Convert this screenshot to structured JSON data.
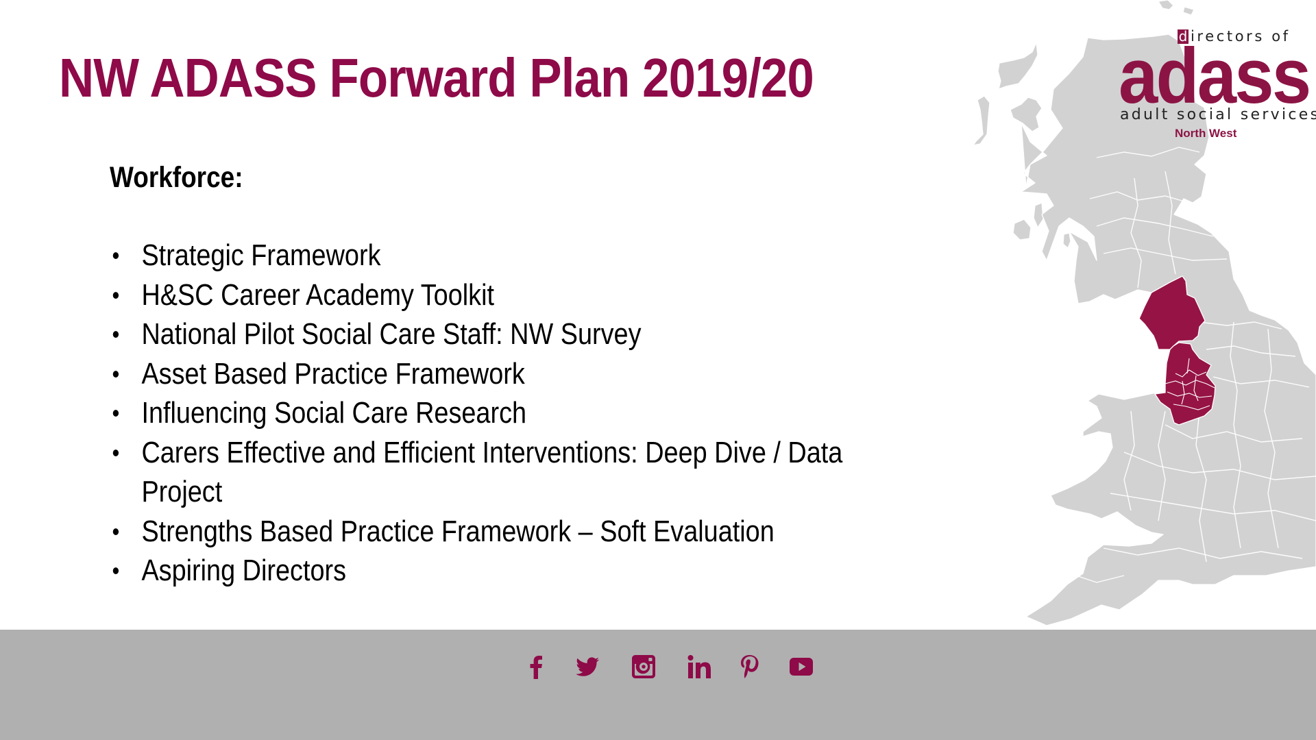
{
  "slide": {
    "title": "NW ADASS Forward Plan 2019/20",
    "section_heading": "Workforce:",
    "items": [
      {
        "lines": [
          "Strategic Framework"
        ]
      },
      {
        "lines": [
          "H&SC Career Academy Toolkit"
        ]
      },
      {
        "lines": [
          "National Pilot Social Care Staff: NW Survey"
        ]
      },
      {
        "lines": [
          "Asset Based Practice Framework"
        ]
      },
      {
        "lines": [
          "Influencing Social Care Research"
        ]
      },
      {
        "lines": [
          "Carers Effective and Efficient Interventions: Deep Dive / Data",
          "Project"
        ]
      },
      {
        "lines": [
          "Strengths Based Practice Framework – Soft Evaluation"
        ]
      },
      {
        "lines": [
          "Aspiring Directors"
        ]
      }
    ],
    "bullet_glyph": "•"
  },
  "logo": {
    "d_letter": "d",
    "directors_of": "irectors of",
    "wordmark": "adass",
    "tagline": "adult social services",
    "region": "North West"
  },
  "map": {
    "description": "Map of Great Britain with North West England region highlighted",
    "highlighted_region": "North West England",
    "colors": {
      "land": "#d2d2d2",
      "highlight": "#961445",
      "borders": "#ffffff"
    }
  },
  "footer": {
    "social_icons": [
      {
        "name": "facebook-icon",
        "label": "Facebook"
      },
      {
        "name": "twitter-icon",
        "label": "Twitter"
      },
      {
        "name": "instagram-icon",
        "label": "Instagram"
      },
      {
        "name": "linkedin-icon",
        "label": "LinkedIn"
      },
      {
        "name": "pinterest-icon",
        "label": "Pinterest"
      },
      {
        "name": "youtube-icon",
        "label": "YouTube"
      }
    ]
  },
  "colors": {
    "brand": "#8e0a48",
    "footer_bg": "#b0b0b0",
    "text": "#000000"
  }
}
